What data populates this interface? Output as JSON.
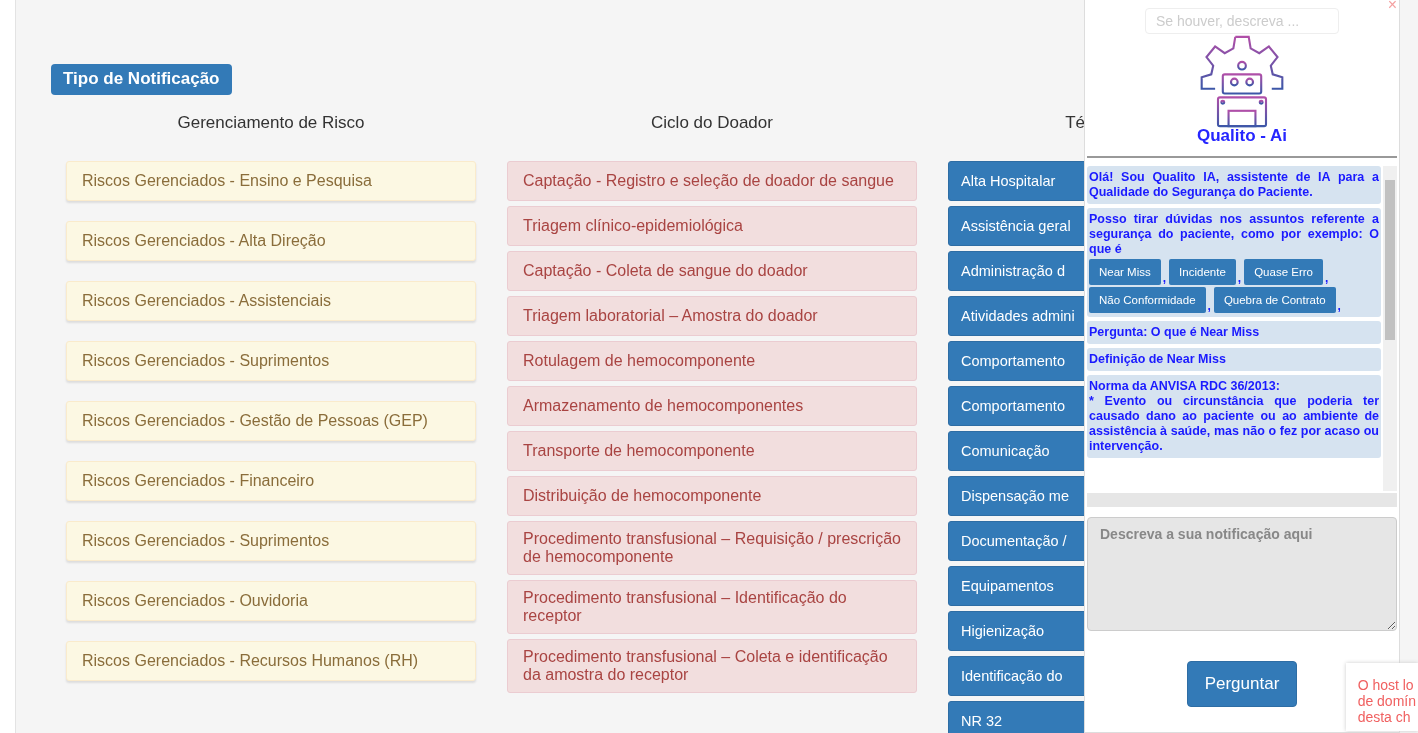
{
  "section_label": "Tipo de Notificação",
  "columns": [
    {
      "title": "Gerenciamento de Risco",
      "kind": "warning",
      "items": [
        "Riscos Gerenciados - Ensino e Pesquisa",
        "Riscos Gerenciados - Alta Direção",
        "Riscos Gerenciados - Assistenciais",
        "Riscos Gerenciados - Suprimentos",
        "Riscos Gerenciados - Gestão de Pessoas (GEP)",
        "Riscos Gerenciados - Financeiro",
        "Riscos Gerenciados - Suprimentos",
        "Riscos Gerenciados - Ouvidoria",
        "Riscos Gerenciados - Recursos Humanos (RH)"
      ]
    },
    {
      "title": "Ciclo do Doador",
      "kind": "danger",
      "items": [
        "Captação - Registro e seleção de doador de sangue",
        "Triagem clínico-epidemiológica",
        "Captação - Coleta de sangue do doador",
        "Triagem laboratorial – Amostra do doador",
        "Rotulagem de hemocomponente",
        "Armazenamento de hemocomponentes",
        "Transporte de hemocomponente",
        "Distribuição de hemocomponente",
        "Procedimento transfusional – Requisição / prescrição de hemocomponente",
        "Procedimento transfusional – Identificação do receptor",
        "Procedimento transfusional – Coleta e identificação da amostra do receptor"
      ]
    },
    {
      "title": "Té",
      "kind": "primary",
      "items": [
        "Alta Hospitalar",
        "Assistência geral",
        "Administração d",
        "Atividades admini",
        "Comportamento",
        "Comportamento",
        "Comunicação",
        "Dispensação me",
        "Documentação /",
        "Equipamentos",
        "Higienização",
        "Identificação do",
        "NR 32"
      ]
    }
  ],
  "assistant": {
    "search_placeholder": "Se houver, descreva ...",
    "name": "Qualito - Ai",
    "messages": [
      {
        "kind": "text",
        "lines": [
          "Olá! Sou Qualito IA, assistente de IA para a Qualidade do Segurança do Paciente."
        ]
      },
      {
        "kind": "chips",
        "text": "Posso tirar dúvidas nos assuntos referente a segurança do paciente, como por exemplo: O que é",
        "separator": ",",
        "chips": [
          "Near Miss",
          "Incidente",
          "Quase Erro",
          "Não Conformidade",
          "Quebra de Contrato"
        ]
      },
      {
        "kind": "text",
        "lines": [
          "Pergunta: O que é Near Miss"
        ]
      },
      {
        "kind": "text",
        "lines": [
          "Definição de Near Miss"
        ]
      },
      {
        "kind": "text",
        "lines": [
          "Norma da ANVISA RDC 36/2013:",
          "* Evento ou circunstância que poderia ter causado dano ao paciente ou ao ambiente de assistência à saúde, mas não o fez por acaso ou intervenção."
        ]
      }
    ],
    "input_placeholder": "Descreva a sua notificação aqui",
    "button": "Perguntar",
    "close": "×"
  },
  "toast": {
    "lines": [
      "O host lo",
      "de domín",
      "desta ch"
    ]
  }
}
